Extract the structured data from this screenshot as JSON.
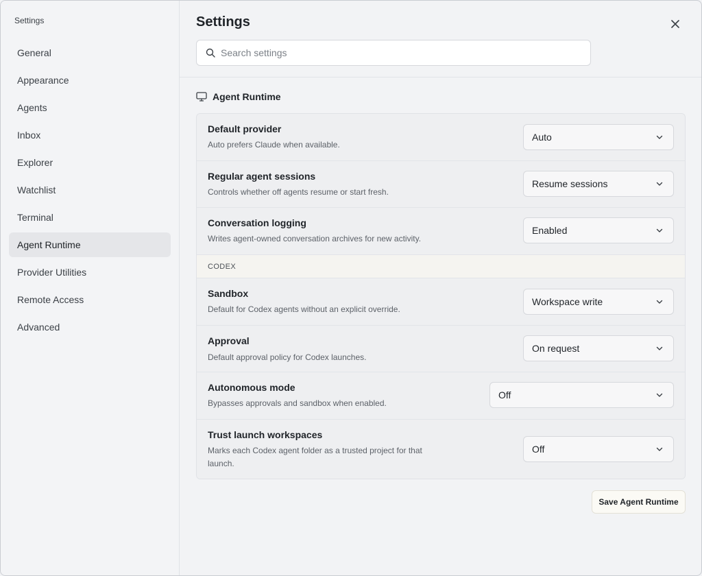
{
  "sidebar": {
    "title": "Settings",
    "items": [
      {
        "label": "General"
      },
      {
        "label": "Appearance"
      },
      {
        "label": "Agents"
      },
      {
        "label": "Inbox"
      },
      {
        "label": "Explorer"
      },
      {
        "label": "Watchlist"
      },
      {
        "label": "Terminal"
      },
      {
        "label": "Agent Runtime",
        "active": true
      },
      {
        "label": "Provider Utilities"
      },
      {
        "label": "Remote Access"
      },
      {
        "label": "Advanced"
      }
    ]
  },
  "header": {
    "title": "Settings",
    "close_icon": "close-icon",
    "search": {
      "placeholder": "Search settings",
      "value": ""
    }
  },
  "section": {
    "icon": "monitor-icon",
    "title": "Agent Runtime"
  },
  "settings": {
    "default_provider": {
      "label": "Default provider",
      "description": "Auto prefers Claude when available.",
      "value": "Auto"
    },
    "regular_sessions": {
      "label": "Regular agent sessions",
      "description": "Controls whether off agents resume or start fresh.",
      "value": "Resume sessions"
    },
    "conversation_logging": {
      "label": "Conversation logging",
      "description": "Writes agent-owned conversation archives for new activity.",
      "value": "Enabled"
    },
    "codex_group": "CODEX",
    "sandbox": {
      "label": "Sandbox",
      "description": "Default for Codex agents without an explicit override.",
      "value": "Workspace write"
    },
    "approval": {
      "label": "Approval",
      "description": "Default approval policy for Codex launches.",
      "value": "On request"
    },
    "autonomous_mode": {
      "label": "Autonomous mode",
      "description": "Bypasses approvals and sandbox when enabled.",
      "value": "Off"
    },
    "trust_workspaces": {
      "label": "Trust launch workspaces",
      "description": "Marks each Codex agent folder as a trusted project for that launch.",
      "value": "Off"
    }
  },
  "footer": {
    "save_label": "Save Agent Runtime"
  },
  "colors": {
    "active_nav": "#e5e6e9",
    "panel_bg": "#eeeff1",
    "group_bg": "#f5f4f0"
  }
}
